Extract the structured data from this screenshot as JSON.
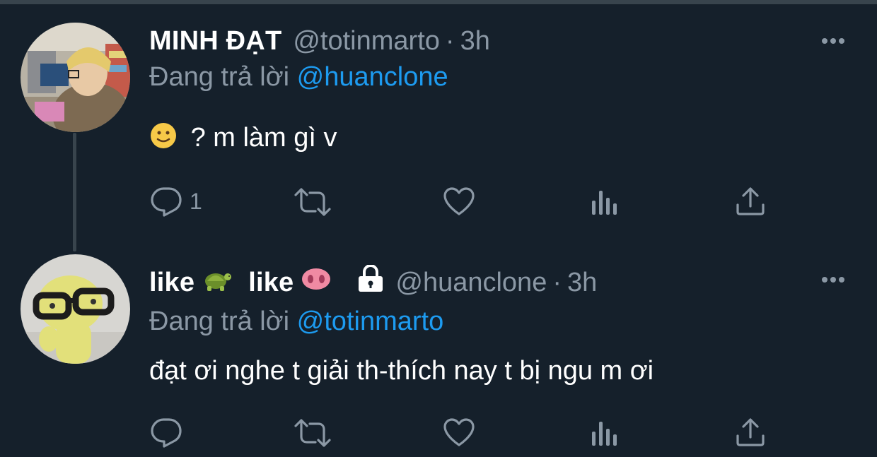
{
  "tweets": [
    {
      "name": "MINH ĐẠT",
      "handle": "@totinmarto",
      "dot": "·",
      "time": "3h",
      "replying_prefix": "Đang trả lời",
      "replying_to": "@huanclone",
      "text": "? m làm gì v",
      "text_emoji": "slightly-smiling-face-emoji",
      "reply_count": "1",
      "icons": [
        "reply-icon",
        "retweet-icon",
        "like-icon",
        "analytics-icon",
        "share-icon",
        "more-icon"
      ]
    },
    {
      "name_part1": "like",
      "name_emoji1": "turtle-emoji",
      "name_part2": "like",
      "name_emoji2": "pig-nose-emoji",
      "protected_icon": "lock-icon",
      "handle": "@huanclone",
      "dot": "·",
      "time": "3h",
      "replying_prefix": "Đang trả lời",
      "replying_to": "@totinmarto",
      "text": "đạt ơi nghe t giải th-thích nay t bị ngu m ơi",
      "reply_count": "",
      "icons": [
        "reply-icon",
        "retweet-icon",
        "like-icon",
        "analytics-icon",
        "share-icon",
        "more-icon"
      ]
    }
  ],
  "colors": {
    "background": "#15202b",
    "text": "#ffffff",
    "secondary": "#8b98a5",
    "accent": "#1d9bf0",
    "divider": "#38444d"
  }
}
